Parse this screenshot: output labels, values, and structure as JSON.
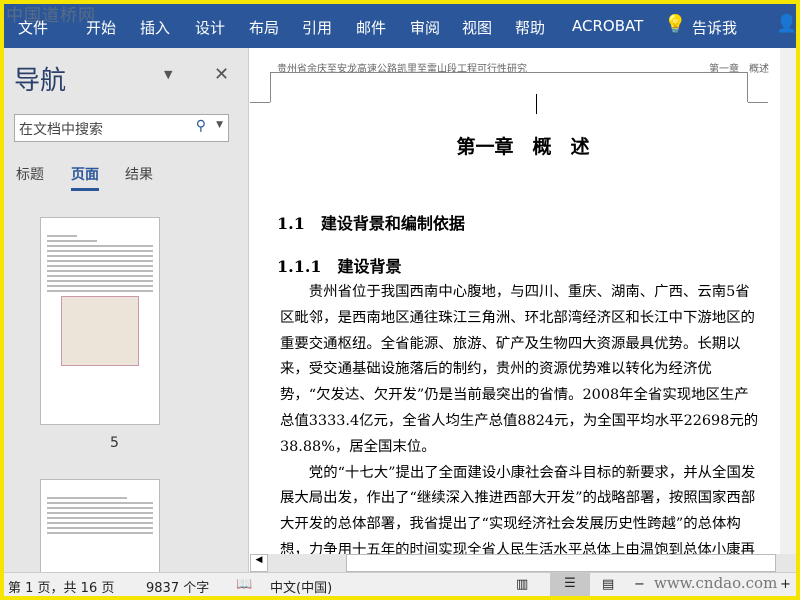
{
  "watermark": "中国道桥网",
  "ribbon": {
    "tabs": [
      "文件",
      "开始",
      "插入",
      "设计",
      "布局",
      "引用",
      "邮件",
      "审阅",
      "视图",
      "帮助",
      "ACROBAT"
    ],
    "tell_me": "告诉我"
  },
  "nav": {
    "title": "导航",
    "search_placeholder": "在文档中搜索",
    "tabs": [
      "标题",
      "页面",
      "结果"
    ],
    "active_tab": "页面",
    "page_label": "5"
  },
  "doc": {
    "header_left": "贵州省余庆至安龙高速公路凯里至雷山段工程可行性研究",
    "header_right": "第一章　概述",
    "chapter": "第一章　概　述",
    "h1": "1.1　建设背景和编制依据",
    "h2": "1.1.1　建设背景",
    "paragraphs": [
      "贵州省位于我国西南中心腹地，与四川、重庆、湖南、广西、云南5省区毗邻，是西南地区通往珠江三角洲、环北部湾经济区和长江中下游地区的重要交通枢纽。全省能源、旅游、矿产及生物四大资源最具优势。长期以来，受交通基础设施落后的制约，贵州的资源优势难以转化为经济优势，“欠发达、欠开发”仍是当前最突出的省情。2008年全省实现地区生产总值3333.4亿元，全省人均生产总值8824元，为全国平均水平22698元的38.88%，居全国末位。",
      "党的“十七大”提出了全面建设小康社会奋斗目标的新要求，并从全国发展大局出发，作出了“继续深入推进西部大开发”的战略部署，按照国家西部大开发的总体部署，我省提出了“实现经济社会发展历史性跨越”的总体构想，力争用十五年的时间实现全省人民生活水平总体上由温饱到总体小康再到全面小康"
    ]
  },
  "status": {
    "page": "第 1 页，共 16 页",
    "words": "9837 个字",
    "language": "中文(中国)",
    "watermark": "www.cndao.com"
  }
}
